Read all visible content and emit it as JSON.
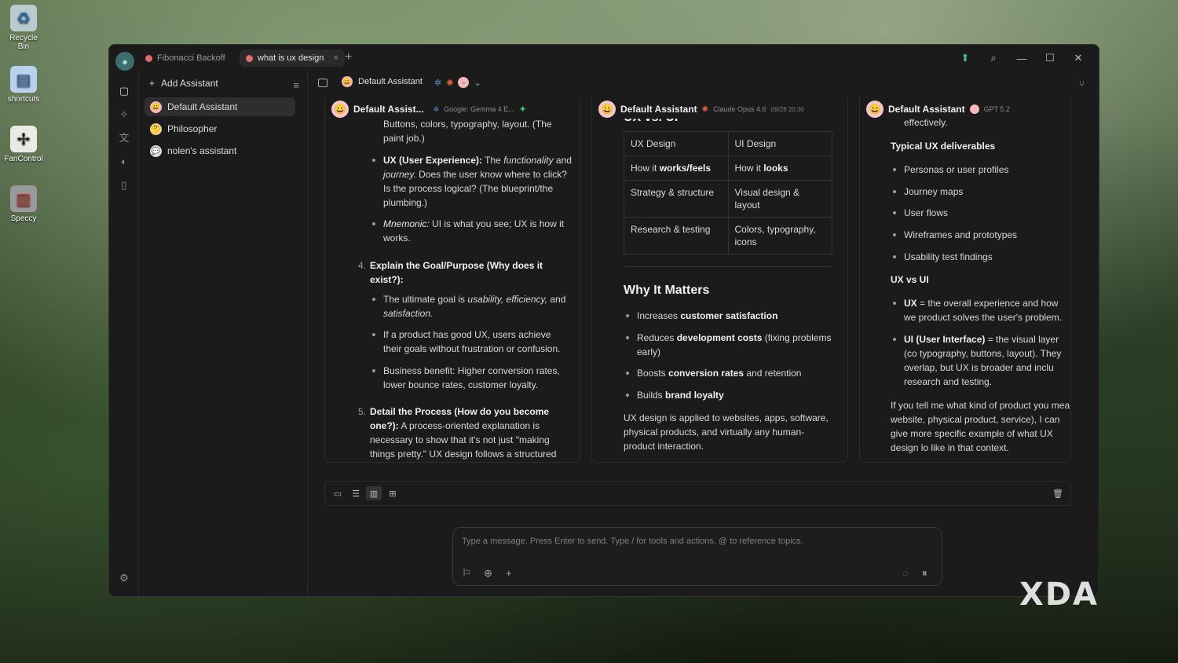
{
  "desktop": {
    "icons": [
      {
        "label": "Recycle Bin",
        "icon": "recycle-bin-icon"
      },
      {
        "label": "shortcuts",
        "icon": "folder-icon"
      },
      {
        "label": "FanControl",
        "icon": "fan-icon"
      },
      {
        "label": "Speccy",
        "icon": "speccy-icon"
      }
    ]
  },
  "titlebar": {
    "tabs": [
      {
        "label": "Fibonacci Backoff",
        "active": false
      },
      {
        "label": "what is ux design",
        "active": true,
        "close": "×"
      }
    ],
    "new_tab": "+",
    "buttons": {
      "update": "⬆",
      "search": "⌕",
      "minimize": "—",
      "maximize": "☐",
      "close": "✕"
    }
  },
  "assistants_panel": {
    "add_label": "Add Assistant",
    "items": [
      {
        "label": "Default Assistant",
        "emoji": "😀",
        "selected": true
      },
      {
        "label": "Philosopher",
        "emoji": "🤔",
        "selected": false
      },
      {
        "label": "nolen's assistant",
        "emoji": "💬",
        "selected": false
      }
    ]
  },
  "header": {
    "assistant": "Default Assistant"
  },
  "columns": [
    {
      "name": "Default Assist...",
      "model": "Google: Gemma 4 E...",
      "content": {
        "intro": "Buttons, colors, typography, layout. (The paint job.)",
        "ux_b": "UX (User Experience):",
        "ux_t1": "The",
        "ux_i1": "functionality",
        "ux_t2": "and",
        "ux_i2": "journey.",
        "ux_t3": "Does the user know where to click? Is the process logical? (The blueprint/the plumbing.)",
        "mn_i": "Mnemonic:",
        "mn_t": "UI is what you see; UX is how it works.",
        "n4": "4.",
        "s4_b": "Explain the Goal/Purpose (Why does it exist?):",
        "g_t1": "The ultimate goal is",
        "g_i": "usability, efficiency,",
        "g_t2": "and",
        "g_i2": "satisfaction.",
        "g2": "If a product has good UX, users achieve their goals without frustration or confusion.",
        "g3": "Business benefit: Higher conversion rates, lower bounce rates, customer loyalty.",
        "n5": "5.",
        "s5_b": "Detail the Process (How do you become one?):",
        "s5_t": "A process-oriented explanation is necessary to show that it's not just \"making things pretty.\" UX design follows a structured"
      }
    },
    {
      "name": "Default Assistant",
      "model": "Claude Opus 4.6",
      "time": "09/28 20:30",
      "content": {
        "table_title": "UX vs. UI",
        "rows": [
          [
            "UX Design",
            "UI Design"
          ],
          [
            "How it works/feels",
            "How it looks"
          ],
          [
            "Strategy & structure",
            "Visual design & layout"
          ],
          [
            "Research & testing",
            "Colors, typography, icons"
          ]
        ],
        "row1_a_pre": "How it",
        "row1_a_b": "works/feels",
        "row1_b_pre": "How it",
        "row1_b_b": "looks",
        "why_title": "Why It Matters",
        "w1_t": "Increases",
        "w1_b": "customer satisfaction",
        "w2_t": "Reduces",
        "w2_b": "development costs",
        "w2_t2": "(fixing problems early)",
        "w3_t": "Boosts",
        "w3_b": "conversion rates",
        "w3_t2": "and retention",
        "w4_t": "Builds",
        "w4_b": "brand loyalty",
        "summary": "UX design is applied to websites, apps, software, physical products, and virtually any human-product interaction."
      }
    },
    {
      "name": "Default Assistant",
      "model": "GPT 5.2",
      "content": {
        "top": "effectively.",
        "deliv_title": "Typical UX deliverables",
        "deliverables": [
          "Personas or user profiles",
          "Journey maps",
          "User flows",
          "Wireframes and prototypes",
          "Usability test findings"
        ],
        "vs_title": "UX vs UI",
        "ux_b": "UX",
        "ux_t": "= the overall experience and how we product solves the user's problem.",
        "ui_b": "UI (User Interface)",
        "ui_t": "= the visual layer (co typography, buttons, layout).",
        "ui_t2": "They overlap, but UX is broader and inclu research and testing.",
        "closing": "If you tell me what kind of product you mea website, physical product, service), I can give more specific example of what UX design lo like in that context."
      }
    }
  ],
  "input": {
    "placeholder": "Type a message. Press Enter to send. Type / for tools and actions, @ to reference topics."
  },
  "watermark": "XDA"
}
